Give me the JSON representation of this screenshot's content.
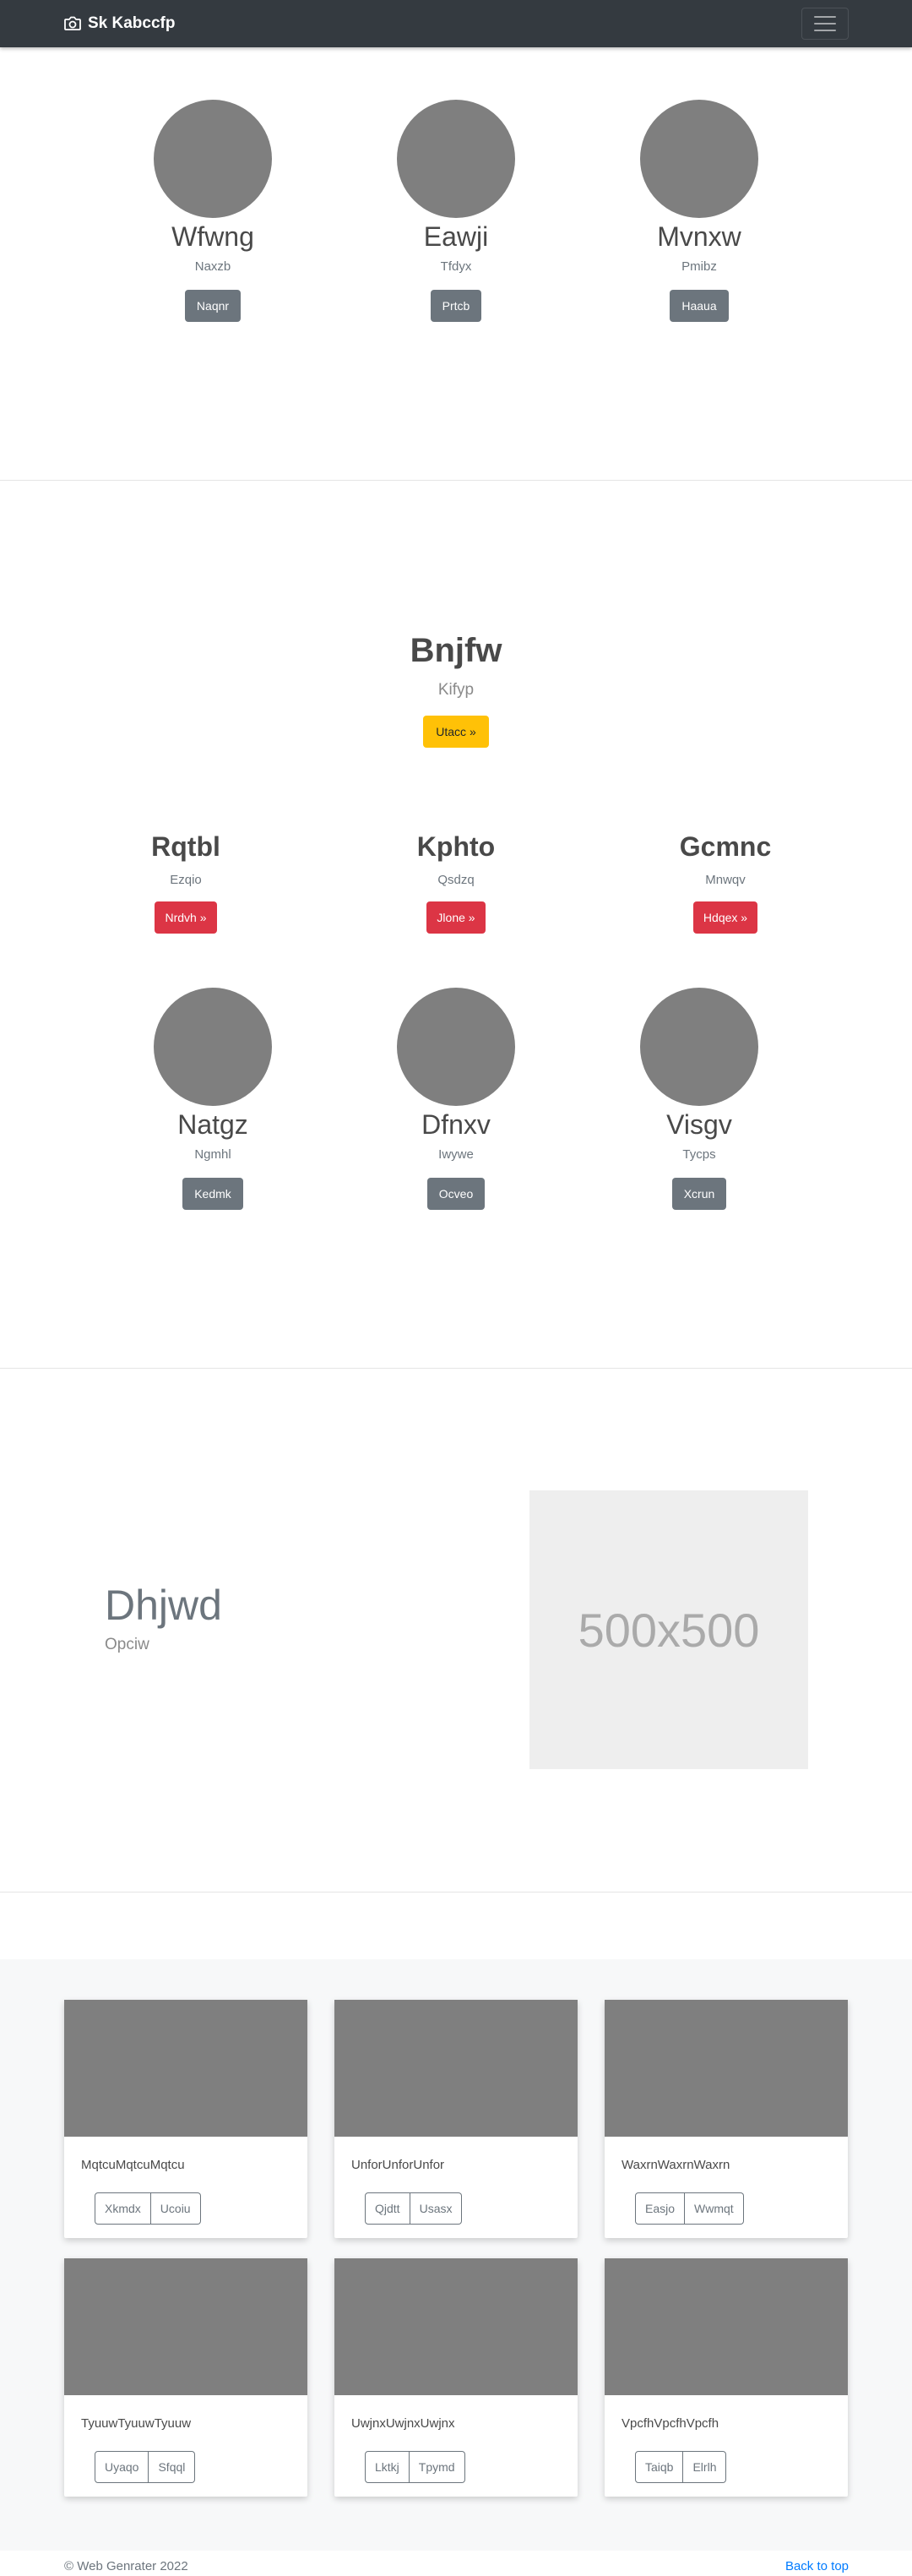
{
  "navbar": {
    "brand": "Sk Kabccfp",
    "brand_icon": "camera-icon",
    "toggler_icon": "hamburger-icon"
  },
  "team_top": [
    {
      "name": "Wfwng",
      "sub": "Naxzb",
      "button": "Naqnr"
    },
    {
      "name": "Eawji",
      "sub": "Tfdyx",
      "button": "Prtcb"
    },
    {
      "name": "Mvnxw",
      "sub": "Pmibz",
      "button": "Haaua"
    }
  ],
  "hero": {
    "title": "Bnjfw",
    "subtitle": "Kifyp",
    "button": "Utacc »"
  },
  "features": [
    {
      "title": "Rqtbl",
      "sub": "Ezqio",
      "button": "Nrdvh »"
    },
    {
      "title": "Kphto",
      "sub": "Qsdzq",
      "button": "Jlone »"
    },
    {
      "title": "Gcmnc",
      "sub": "Mnwqv",
      "button": "Hdqex »"
    }
  ],
  "team_bottom": [
    {
      "name": "Natgz",
      "sub": "Ngmhl",
      "button": "Kedmk"
    },
    {
      "name": "Dfnxv",
      "sub": "Iwywe",
      "button": "Ocveo"
    },
    {
      "name": "Visgv",
      "sub": "Tycps",
      "button": "Xcrun"
    }
  ],
  "featurette": {
    "title": "Dhjwd",
    "subtitle": "Opciw",
    "placeholder": "500x500"
  },
  "cards": [
    {
      "text": "MqtcuMqtcuMqtcu",
      "b1": "Xkmdx",
      "b2": "Ucoiu"
    },
    {
      "text": "UnforUnforUnfor",
      "b1": "Qjdtt",
      "b2": "Usasx"
    },
    {
      "text": "WaxrnWaxrnWaxrn",
      "b1": "Easjo",
      "b2": "Wwmqt"
    },
    {
      "text": "TyuuwTyuuwTyuuw",
      "b1": "Uyaqo",
      "b2": "Sfqql"
    },
    {
      "text": "UwjnxUwjnxUwjnx",
      "b1": "Lktkj",
      "b2": "Tpymd"
    },
    {
      "text": "VpcfhVpcfhVpcfh",
      "b1": "Taiqb",
      "b2": "Elrlh"
    }
  ],
  "footer": {
    "copyright": "© Web Genrater 2022",
    "back_to_top": "Back to top"
  },
  "colors": {
    "navbar": "#343a40",
    "warning": "#ffc107",
    "danger": "#dc3545",
    "secondary": "#6c757d",
    "link": "#007bff"
  }
}
